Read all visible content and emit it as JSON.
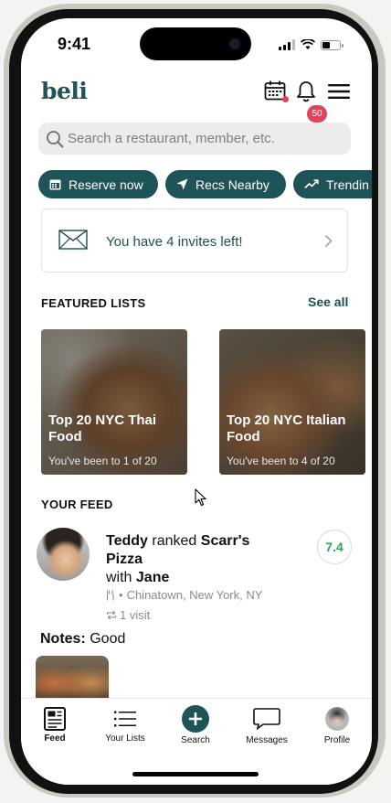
{
  "status_bar": {
    "time": "9:41"
  },
  "header": {
    "logo": "beli",
    "notification_count": "50",
    "icons": [
      "calendar-icon",
      "bell-icon",
      "menu-icon"
    ]
  },
  "search": {
    "placeholder": "Search a restaurant, member, etc."
  },
  "chips": [
    {
      "label": "Reserve now",
      "icon": "calendar-icon"
    },
    {
      "label": "Recs Nearby",
      "icon": "location-arrow-icon"
    },
    {
      "label": "Trendin",
      "icon": "trending-up-icon"
    }
  ],
  "invite": {
    "text": "You have 4 invites left!"
  },
  "featured": {
    "title": "FEATURED LISTS",
    "see_all": "See all",
    "lists": [
      {
        "title": "Top 20 NYC Thai Food",
        "subtitle": "You've been to 1 of 20"
      },
      {
        "title": "Top 20 NYC Italian Food",
        "subtitle": "You've been to 4 of 20"
      }
    ]
  },
  "feed": {
    "title": "YOUR FEED",
    "item": {
      "user": "Teddy",
      "action": "ranked",
      "restaurant": "Scarr's Pizza",
      "with_prefix": "with",
      "with_user": "Jane",
      "location": "Chinatown, New York, NY",
      "visits": "1 visit",
      "score": "7.4",
      "notes_label": "Notes:",
      "notes": "Good"
    }
  },
  "tabs": [
    {
      "label": "Feed",
      "icon": "feed-icon"
    },
    {
      "label": "Your Lists",
      "icon": "list-icon"
    },
    {
      "label": "Search",
      "icon": "plus-icon"
    },
    {
      "label": "Messages",
      "icon": "chat-bubble-icon"
    },
    {
      "label": "Profile",
      "icon": "avatar"
    }
  ],
  "colors": {
    "brand": "#1e5357",
    "badge": "#e0435a",
    "score": "#2ca55a"
  }
}
